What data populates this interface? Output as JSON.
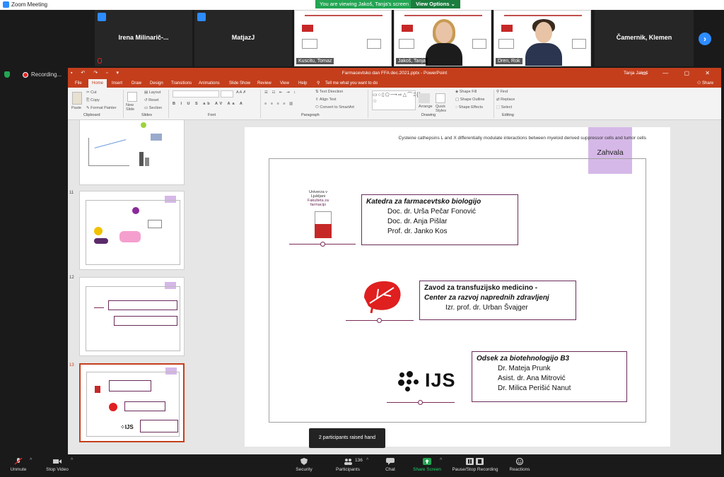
{
  "window": {
    "title": "Zoom Meeting"
  },
  "viewing_banner": {
    "text": "You are viewing Jakoš, Tanja's screen",
    "options_label": "View Options"
  },
  "gallery": {
    "participants": [
      {
        "name": "Irena  Milinarič-...",
        "video": false,
        "muted": true
      },
      {
        "name": "MatjazJ",
        "video": false,
        "muted": false
      },
      {
        "name": "Kuscitu, Tomaz",
        "video": true,
        "kind": "slide"
      },
      {
        "name": "Jakoš, Tanja",
        "video": true,
        "kind": "person-female"
      },
      {
        "name": "Dren, Rok",
        "video": true,
        "kind": "person-male"
      },
      {
        "name": "Čamernik, Klemen",
        "video": false,
        "muted": false
      }
    ],
    "next_icon": "chevron-right-icon"
  },
  "recording": {
    "label": "Recording..."
  },
  "powerpoint": {
    "title": "Farmacevtsko dan FFA dec.2021.pptx  -  PowerPoint",
    "user": "Tanja Jakoš",
    "tabs": [
      "File",
      "Home",
      "Insert",
      "Draw",
      "Design",
      "Transitions",
      "Animations",
      "Slide Show",
      "Review",
      "View",
      "Help",
      "Tell me what you want to do"
    ],
    "active_tab": "Home",
    "share_label": "Share",
    "ribbon": {
      "clipboard": {
        "paste": "Paste",
        "cut": "Cut",
        "copy": "Copy",
        "format_painter": "Format Painter",
        "group": "Clipboard"
      },
      "slides": {
        "new_slide": "New Slide",
        "layout": "Layout",
        "reset": "Reset",
        "section": "Section",
        "group": "Slides"
      },
      "font": {
        "group": "Font"
      },
      "paragraph": {
        "text_direction": "Text Direction",
        "align_text": "Align Text",
        "convert_smartart": "Convert to SmartArt",
        "group": "Paragraph"
      },
      "drawing": {
        "arrange": "Arrange",
        "quick_styles": "Quick Styles",
        "shape_fill": "Shape Fill",
        "shape_outline": "Shape Outline",
        "shape_effects": "Shape Effects",
        "group": "Drawing"
      },
      "editing": {
        "find": "Find",
        "replace": "Replace",
        "select": "Select",
        "group": "Editing"
      }
    },
    "thumbnails": [
      {
        "number": "",
        "selected": false
      },
      {
        "number": "11",
        "selected": false
      },
      {
        "number": "12",
        "selected": false
      },
      {
        "number": "13",
        "selected": true
      }
    ],
    "slide": {
      "header": "Cysteine cathepsins L and X differentially modulate interactions between myeloid derived suppressor cells and tumor cells",
      "tag": "Zahvala",
      "blocks": [
        {
          "logo_text_1": "Univerza v Ljubljani",
          "logo_text_2": "Fakulteta za farmacijo",
          "heading": "Katedra za farmacevtsko biologijo",
          "lines": [
            "Doc. dr. Urša Pečar Fonović",
            "Doc. dr. Anja Pišlar",
            "Prof. dr. Janko Kos"
          ]
        },
        {
          "heading": "Zavod za transfuzijsko medicino -",
          "heading2": "Center za razvoj naprednih zdravljenj",
          "lines": [
            "Izr. prof. dr. Urban Švajger"
          ]
        },
        {
          "logo_text": "IJS",
          "heading": "Odsek za biotehnologijo B3",
          "lines": [
            "Dr. Mateja Prunk",
            "Asist. dr. Ana Mitrović",
            "Dr. Milica Perišić Nanut"
          ]
        }
      ]
    }
  },
  "tooltip": {
    "text": "2 participants raised hand"
  },
  "toolbar": {
    "unmute": "Unmute",
    "stop_video": "Stop Video",
    "security": "Security",
    "participants": "Participants",
    "participants_count": "136",
    "chat": "Chat",
    "share_screen": "Share Screen",
    "pause_recording": "Pause/Stop Recording",
    "reactions": "Reactions"
  },
  "colors": {
    "ppt_accent": "#c43e1c",
    "zoom_blue": "#2d8cff",
    "zoom_green": "#23a553",
    "slide_tag": "#d6b8e8",
    "box_border": "#6a2a5a"
  }
}
